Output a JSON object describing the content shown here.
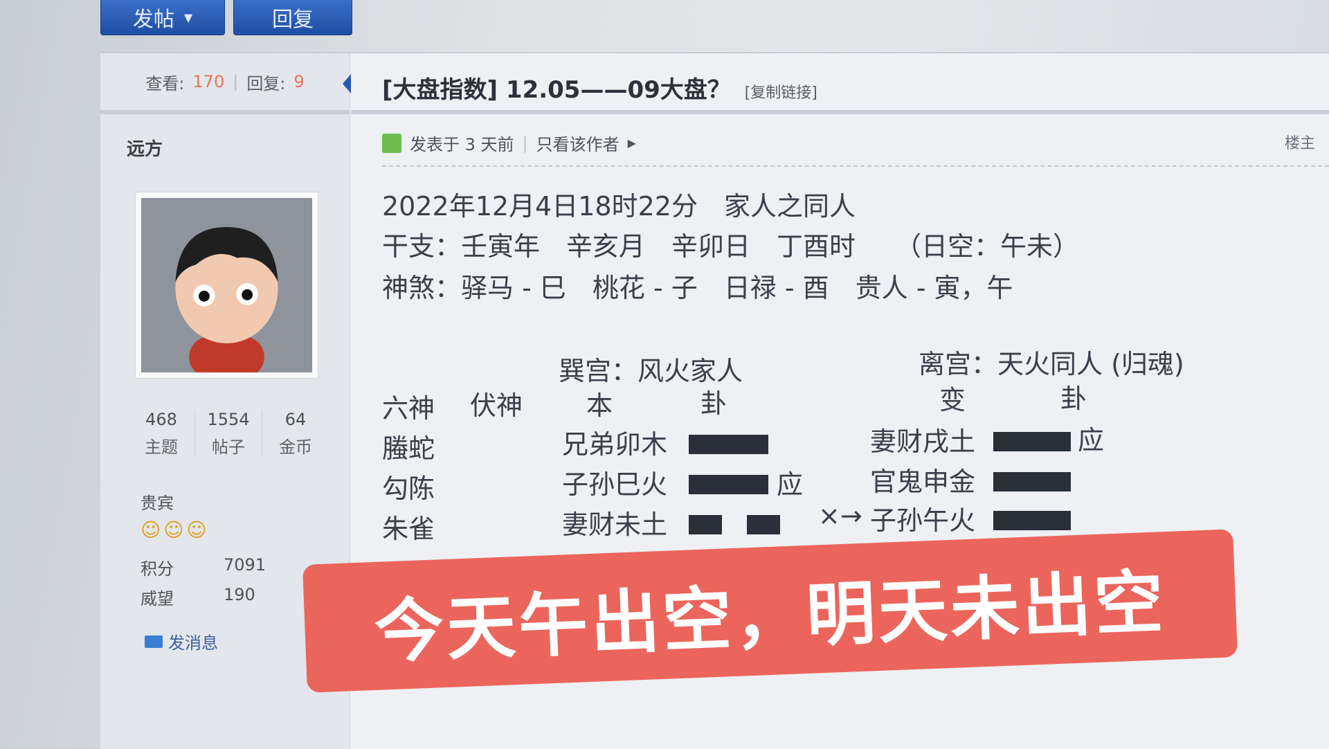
{
  "toolbar": {
    "post_label": "发帖",
    "reply_label": "回复"
  },
  "stats": {
    "views_label": "查看:",
    "views": "170",
    "replies_label": "回复:",
    "replies": "9"
  },
  "author": {
    "name": "远方",
    "topics": "468",
    "topics_label": "主题",
    "posts": "1554",
    "posts_label": "帖子",
    "coins": "64",
    "coins_label": "金币",
    "rank": "贵宾",
    "points_label": "积分",
    "points": "7091",
    "prestige_label": "威望",
    "prestige": "190",
    "message_label": "发消息"
  },
  "thread": {
    "title": "[大盘指数] 12.05——09大盘？",
    "copy_link": "[复制链接]",
    "posted": "发表于 3 天前",
    "only_author": "只看该作者",
    "floor": "楼主"
  },
  "content": {
    "line1": "2022年12月4日18时22分　家人之同人",
    "line2": "干支：壬寅年　辛亥月　辛卯日　丁酉时　　（日空：午未）",
    "line3": "神煞：驿马 - 巳　桃花 - 子　日禄 - 酉　贵人 - 寅，午",
    "palace_left": "巽宫：风火家人",
    "palace_right": "离宫：天火同人 (归魂)",
    "head_liushen": "六神",
    "head_fushen": "伏神",
    "head_ben": "本",
    "head_gua": "卦",
    "head_bian": "变",
    "head_gua2": "卦",
    "rows": [
      {
        "god": "螣蛇",
        "line": "兄弟卯木",
        "mark": "",
        "arrow": "",
        "changed": "妻财戌土",
        "mark2": "应"
      },
      {
        "god": "勾陈",
        "line": "子孙巳火",
        "mark": "应",
        "arrow": "",
        "changed": "官鬼申金",
        "mark2": ""
      },
      {
        "god": "朱雀",
        "line": "妻财未土",
        "mark": "",
        "arrow": "×→",
        "changed": "子孙午火",
        "mark2": ""
      }
    ]
  },
  "banner": "今天午出空，明天未出空"
}
